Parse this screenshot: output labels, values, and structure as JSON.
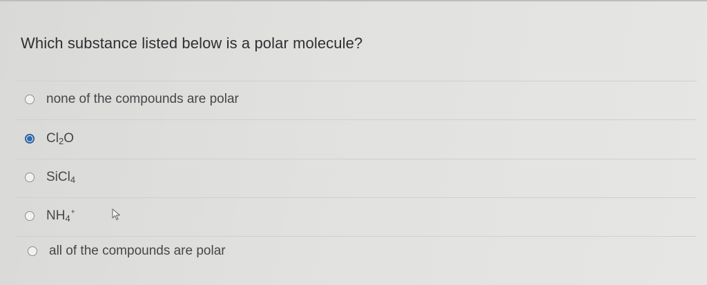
{
  "question": {
    "text": "Which substance listed below is a polar molecule?"
  },
  "options": [
    {
      "label": "none of the compounds are polar",
      "selected": false
    },
    {
      "base": "Cl",
      "sub": "2",
      "rest": "O",
      "selected": true
    },
    {
      "base": "SiCl",
      "sub": "4",
      "selected": false
    },
    {
      "base": "NH",
      "sub": "4",
      "sup": "+",
      "selected": false
    },
    {
      "label": "all of the compounds are polar",
      "selected": false
    }
  ],
  "colors": {
    "accent": "#2d6db3",
    "text": "#3a3a3c"
  },
  "icons": {
    "pointer": "mouse-pointer-icon"
  }
}
